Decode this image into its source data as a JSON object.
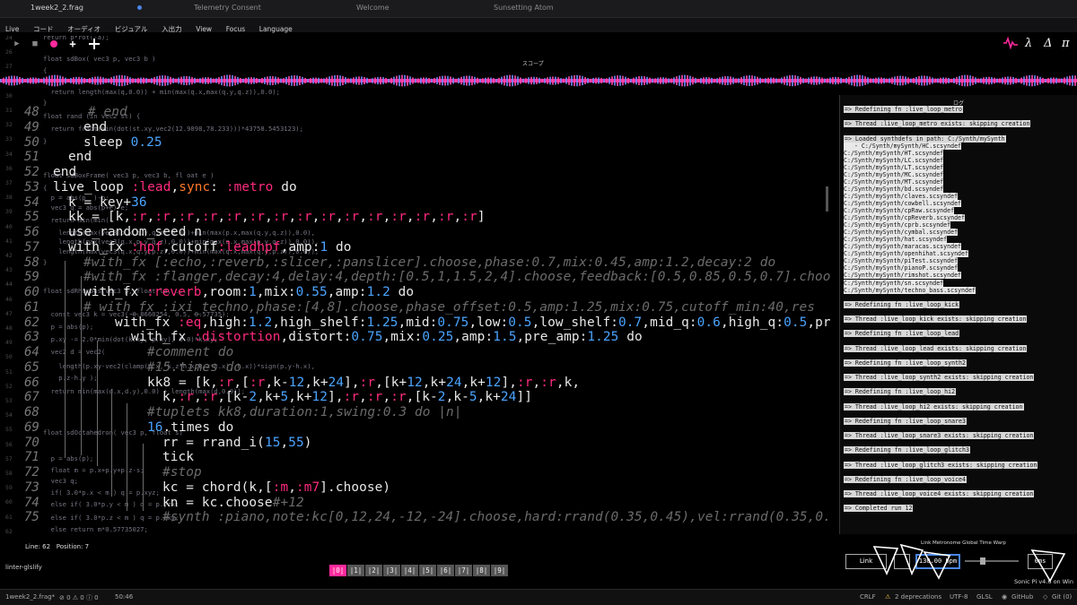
{
  "tabs": [
    {
      "label": "1week2_2.frag",
      "active": true
    },
    {
      "label": "Telemetry Consent",
      "active": false
    },
    {
      "label": "Welcome",
      "active": false
    },
    {
      "label": "Sunsetting Atom",
      "active": false
    }
  ],
  "menu": [
    "Live",
    "コード",
    "オーディオ",
    "ビジュアル",
    "入出力",
    "View",
    "Focus",
    "Language"
  ],
  "toolbar": {
    "right_icons": [
      "λ",
      "Δ",
      "π"
    ],
    "scope_label": "スコープ"
  },
  "glsl_lines": [
    "return p*rot(-a);",
    "float sdBox( vec3 p, vec3 b )",
    "{",
    "  return length(max(q,0.0)) + min(max(q.x,max(q.y,q.z)),0.0);",
    "}",
    "float rand (in vec2 st) {",
    "  return fract(sin(dot(st.xy,vec2(12.9898,78.233)))*43758.5453123);",
    "}",
    "float sdBoxFrame( vec3 p, vec3 b, fl oat e )",
    "{",
    "  p = abs(p  )-b;",
    "  vec3 q = abs(p+e)-e;",
    "  return min(min(",
    "    length(max(vec3(p.x,q.y,q.z),0.0))+min(max(p.x,max(q.y,q.z)),0.0),",
    "    length(max(vec3(q.x,p.y,q.z),0.0))+min(max(q.x,max(p.y,q.z)),0.0)),",
    "    length(max(vec3(q.x,q.y,p.z),0.0))+min(max(q.x,max(q.y,p.z)),0.0));",
    "}",
    "float sdRhombus(vec3 p, float la, ...",
    "  const vec3 k = vec3(-0.8660254, 0.5, 0.57735);",
    "  p = abs(p);",
    "  p.xy -= 2.0*min(dot(k.xy, p.xy), 0.0)*k.xy;",
    "  vec2 d = vec2(",
    "    length(p.xy-vec2(clamp(p.x,-k.z*h.x,k.z*h.x), h.x))*sign(p.y-h.x),",
    "    p.z-h.y );",
    "  return min(max(d.x,d.y),0.0) + length(max(d,0.0));",
    "float sdOctahedron( vec3 p, float s)",
    "  p = abs(p);",
    "  float m = p.x+p.y+p.z-s;",
    "  vec3 q;",
    "  if( 3.0*p.x < m ) q = p.xyz;",
    "  else if( 3.0*p.y < m ) q = p.yzx;",
    "  else if( 3.0*p.z < m ) q = p.zxy;",
    "  else return m*0.57735027;",
    "  float k = clamp(0.5*(q.z-q.y+s),0.0,s);"
  ],
  "gutter_small": [
    "24",
    "26",
    "27",
    "28",
    "30",
    "31",
    "32",
    "33",
    "34",
    "36",
    "37",
    "38",
    "39",
    "40",
    "41",
    "42",
    "43",
    "44",
    "46",
    "47",
    "48",
    "49",
    "50",
    "51",
    "52",
    "53",
    "54",
    "55",
    "56",
    "57",
    "58",
    "59",
    "60",
    "61",
    "62",
    "63",
    "64"
  ],
  "big_nums": [
    "48",
    "49",
    "50",
    "51",
    "52",
    "53",
    "54",
    "55",
    "56",
    "57",
    "58",
    "59",
    "60",
    "61",
    "62",
    "63",
    "64",
    "65",
    "66",
    "67",
    "68",
    "69",
    "70",
    "71",
    "72",
    "73",
    "74",
    "75"
  ],
  "sonic_lines": [
    "# end",
    "end",
    "sleep 0.25",
    "end",
    "end",
    "live_loop :lead,sync: :metro do",
    "k = key+36",
    "kk = [k,:r,:r,:r,:r,:r,:r,:r,:r,:r,:r,:r,:r,:r,:r,:r]",
    "use_random_seed n",
    "with_fx :hpf,cutoff:leadhpf,amp:1 do",
    "#with_fx [:echo,:reverb,:slicer,:panslicer].choose,phase:0.7,mix:0.45,amp:1.2,decay:2 do",
    "#with_fx :flanger,decay:4,delay:4,depth:[0.5,1,1.5,2,4].choose,feedback:[0.5,0.85,0.5,0.7].choo",
    "with_fx :reverb,room:1,mix:0.55,amp:1.2 do",
    "# with_fx :ixi_techno,phase:[4,8].choose,phase_offset:0.5,amp:1.25,mix:0.75,cutoff_min:40,res",
    "with_fx :eq,high:1.2,high_shelf:1.25,mid:0.75,low:0.5,low_shelf:0.7,mid_q:0.6,high_q:0.5,pr",
    "with_fx :distortion,distort:0.75,mix:0.25,amp:1.5,pre_amp:1.25 do",
    "#comment do",
    "#15.times do",
    "kk8 = [k,:r,[:r,k-12,k+24],:r,[k+12,k+24,k+12],:r,:r,k,",
    "k,:r,:r,[k-2,k+5,k+12],:r,:r,:r,[k-2,k-5,k+24]]",
    "#tuplets kk8,duration:1,swing:0.3 do |n|",
    "16.times do",
    "rr = rrand_i(15,55)",
    "tick",
    "#stop",
    "kc = chord(k,[:m,:m7].choose)",
    "kn = kc.choose#+12",
    "#synth :piano,note:kc[0,12,24,-12,-24].choose,hard:rrand(0.35,0.45),vel:rrand(0.35,0."
  ],
  "log": {
    "title": "ログ",
    "entries": [
      "=> Redefining fn :live_loop_metro",
      "=> Thread :live_loop_metro exists: skipping creation",
      "=> Loaded synthdefs in path: C:/Synth/mySynth",
      "   - C:/Synth/mySynth/HC.scsyndef",
      "C:/Synth/mySynth/HT.scsyndef",
      "C:/Synth/mySynth/LC.scsyndef",
      "C:/Synth/mySynth/LT.scsyndef",
      "C:/Synth/mySynth/MC.scsyndef",
      "C:/Synth/mySynth/MT.scsyndef",
      "C:/Synth/mySynth/bd.scsyndef",
      "C:/Synth/mySynth/claves.scsyndef",
      "C:/Synth/mySynth/cowbell.scsyndef",
      "C:/Synth/mySynth/cpRaw.scsyndef",
      "C:/Synth/mySynth/cpReverb.scsyndef",
      "C:/Synth/mySynth/cprb.scsyndef",
      "C:/Synth/mySynth/cymbal.scsyndef",
      "C:/Synth/mySynth/hat.scsyndef",
      "C:/Synth/mySynth/maracas.scsyndef",
      "C:/Synth/mySynth/openhihat.scsyndef",
      "C:/Synth/mySynth/piTest.scsyndef",
      "C:/Synth/mySynth/pianoP.scsyndef",
      "C:/Synth/mySynth/rimshot.scsyndef",
      "C:/Synth/mySynth/sn.scsyndef",
      "C:/Synth/mySynth/techno_bass.scsyndef",
      "=> Redefining fn :live_loop_kick",
      "=> Thread :live_loop_kick exists: skipping creation",
      "=> Redefining fn :live_loop_lead",
      "=> Thread :live_loop_lead exists: skipping creation",
      "=> Redefining fn :live_loop_synth2",
      "=> Thread :live_loop_synth2 exists: skipping creation",
      "=> Redefining fn :live_loop_hi2",
      "=> Thread :live_loop_hi2 exists: skipping creation",
      "=> Redefining fn :live_loop_snare3",
      "=> Thread :live_loop_snare3 exists: skipping creation",
      "=> Redefining fn :live_loop_glitch3",
      "=> Thread :live_loop_glitch3 exists: skipping creation",
      "=> Redefining fn :live_loop_voice4",
      "=> Thread :live_loop_voice4 exists: skipping creation",
      "=> Completed run 12"
    ]
  },
  "status": {
    "line_label": "Line: 62",
    "position_label": "Position: 7",
    "linter": "linter-glslify",
    "buffers": [
      "|0|",
      "|1|",
      "|2|",
      "|3|",
      "|4|",
      "|5|",
      "|6|",
      "|7|",
      "|8|",
      "|9|"
    ],
    "active_buffer": 0
  },
  "link": {
    "label": "Link Metronome  Global Time Warp",
    "link_button": "Link",
    "bpm": "130.00 bpm",
    "time_warp": "0ms",
    "version": "Sonic Pi v4.6 on Win"
  },
  "footer": {
    "file": "1week2_2.frag*",
    "counts": "⊘ 0  ⚠ 0  ⓘ 0",
    "cursor": "50:46",
    "crlf": "CRLF",
    "deprecations": "2 deprecations",
    "encoding": "UTF-8",
    "grammar": "GLSL",
    "github": "GitHub",
    "git": "Git (0)"
  },
  "colors": {
    "accent_pink": "#ff2a9c",
    "symbol": "#ff2a7e",
    "keyword": "#ff7a29",
    "number": "#4aa4ff"
  }
}
